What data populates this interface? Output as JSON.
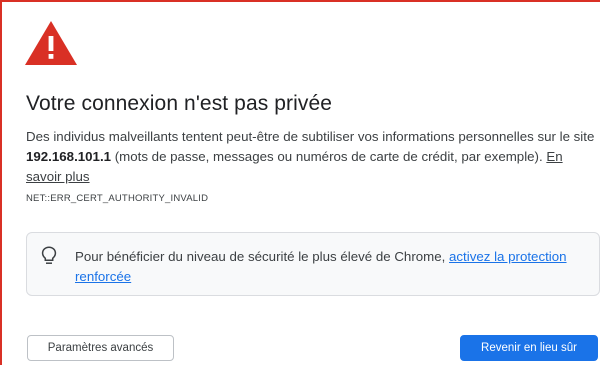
{
  "page": {
    "heading": "Votre connexion n'est pas privée",
    "paragraph_before_host": "Des individus malveillants tentent peut-être de subtiliser vos informations personnelles sur le site ",
    "host": "192.168.101.1",
    "paragraph_after_host": " (mots de passe, messages ou numéros de carte de crédit, par exemple). ",
    "learn_more_label": "En savoir plus",
    "error_code": "NET::ERR_CERT_AUTHORITY_INVALID"
  },
  "enhanced_protection": {
    "icon": "lightbulb-icon",
    "text": "Pour bénéficier du niveau de sécurité le plus élevé de Chrome, ",
    "link_label": "activez la protection renforcée"
  },
  "buttons": {
    "advanced_label": "Paramètres avancés",
    "back_label": "Revenir en lieu sûr"
  },
  "colors": {
    "warning_red": "#d93025",
    "primary_blue": "#1a73e8",
    "text": "#202124",
    "secondary_text": "#3c4043"
  },
  "icons": {
    "warning": "warning-triangle-icon",
    "bulb": "lightbulb-icon"
  }
}
